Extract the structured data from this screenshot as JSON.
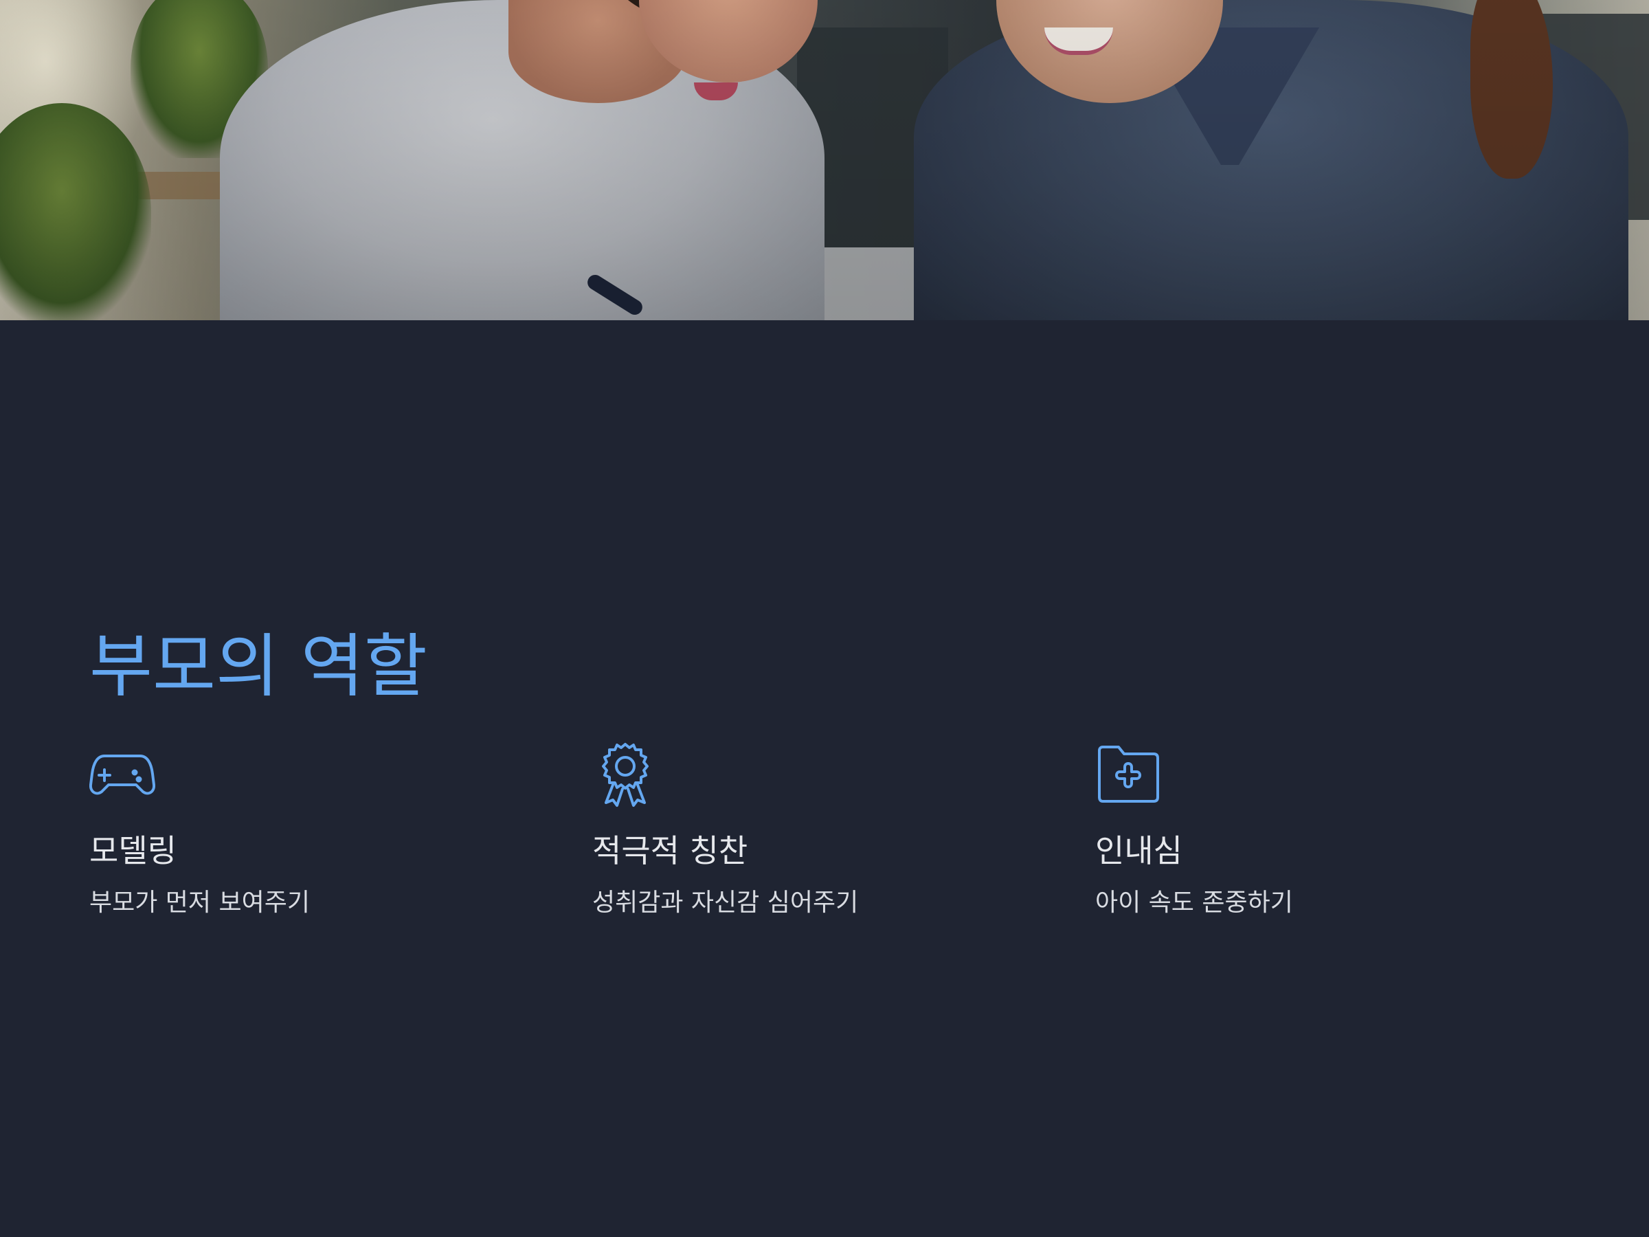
{
  "slide": {
    "title": "부모의 역할",
    "accent_color": "#64a7f0",
    "background_color": "#1f2432",
    "hero_image": "two-women-smiling-writing-photo"
  },
  "features": [
    {
      "icon": "gamepad-icon",
      "title": "모델링",
      "description": "부모가 먼저 보여주기"
    },
    {
      "icon": "award-ribbon-icon",
      "title": "적극적 칭찬",
      "description": "성취감과 자신감 심어주기"
    },
    {
      "icon": "folder-plus-icon",
      "title": "인내심",
      "description": "아이 속도 존중하기"
    }
  ]
}
